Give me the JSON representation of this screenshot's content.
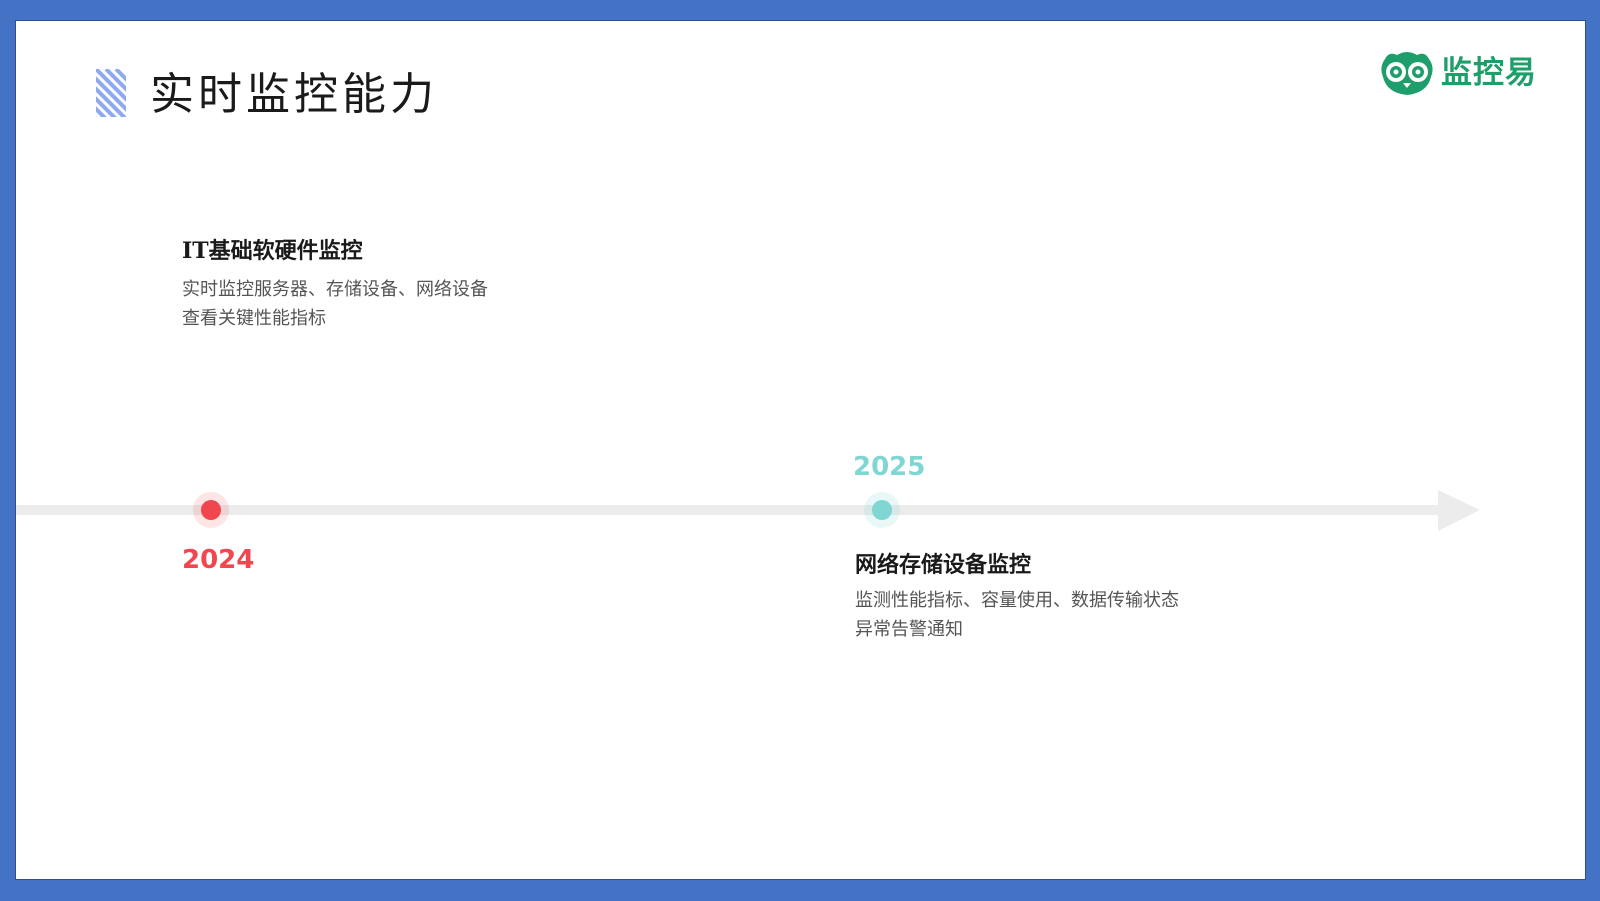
{
  "page": {
    "title": "实时监控能力"
  },
  "brand": {
    "name": "监控易",
    "icon": "owl-logo-icon",
    "color": "#1e9e6a"
  },
  "timeline": {
    "track_color": "#ececec",
    "milestones": [
      {
        "year": "2024",
        "color": "#f0474f",
        "title": "IT基础软硬件监控",
        "lines": [
          "实时监控服务器、存储设备、网络设备",
          "查看关键性能指标"
        ]
      },
      {
        "year": "2025",
        "color": "#7fd6d3",
        "title": "网络存储设备监控",
        "lines": [
          "监测性能指标、容量使用、数据传输状态",
          "异常告警通知"
        ]
      }
    ]
  },
  "colors": {
    "frame": "#4472c4",
    "title_marker": "#8fa9f0"
  }
}
